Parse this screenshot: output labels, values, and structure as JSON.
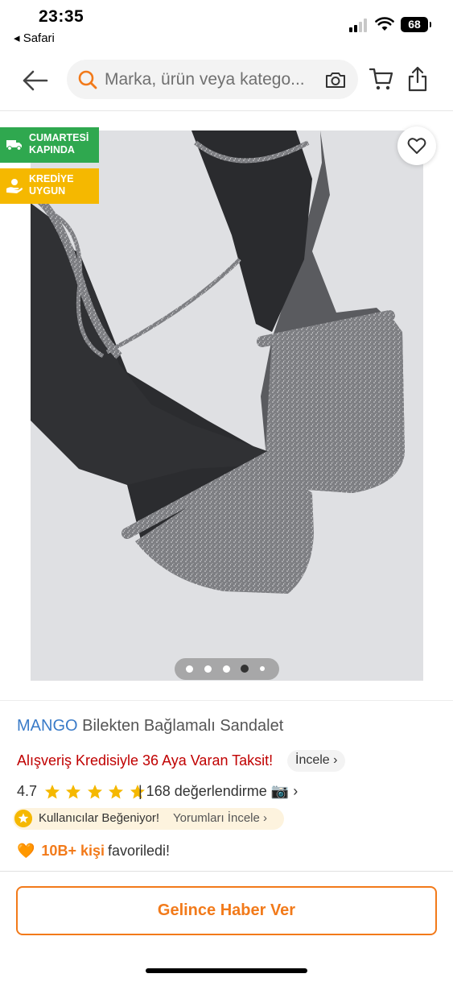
{
  "status_bar": {
    "time": "23:35",
    "back_app": "◂ Safari",
    "battery": "68"
  },
  "header": {
    "search_placeholder": "Marka, ürün veya katego..."
  },
  "badges": [
    {
      "line1": "CUMARTESİ",
      "line2": "KAPINDA",
      "color": "#2fa84f"
    },
    {
      "line1": "KREDİYE",
      "line2": "UYGUN",
      "color": "#f5b800"
    }
  ],
  "gallery": {
    "image_count": 5,
    "active_index": 3
  },
  "product": {
    "brand": "MANGO",
    "name": "Bilekten Bağlamalı Sandalet",
    "credit_text": "Alışveriş Kredisiyle 36 Aya Varan Taksit!",
    "credit_link": "İncele ›",
    "rating": "4.7",
    "stars": 5,
    "rating_count": "| 168 değerlendirme 📷 ›",
    "liked_text": "Kullanıcılar Beğeniyor!",
    "liked_link": "Yorumları İncele ›",
    "fav_heart": "🧡",
    "fav_count": "10B+ kişi",
    "fav_text": "favoriledi!"
  },
  "cta": {
    "label": "Gelince Haber Ver"
  },
  "colors": {
    "accent": "#f27a1a",
    "brand_blue": "#3a7bc8",
    "credit_red": "#c00000",
    "star": "#f5b800"
  }
}
